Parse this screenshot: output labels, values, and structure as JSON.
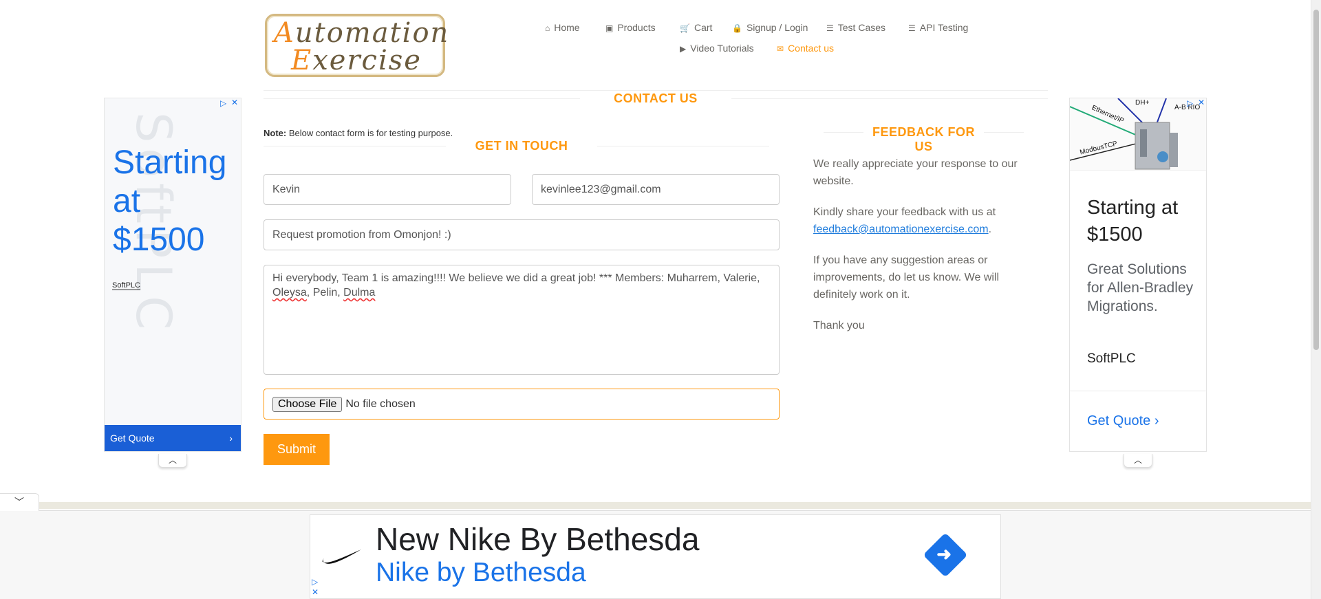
{
  "header": {
    "logo_line1_cap": "A",
    "logo_line1_rest": "utomation",
    "logo_line2_cap": "E",
    "logo_line2_rest": "xercise",
    "nav": [
      {
        "label": "Home",
        "icon": "⌂"
      },
      {
        "label": "Products",
        "icon": "▣"
      },
      {
        "label": "Cart",
        "icon": "🛒"
      },
      {
        "label": "Signup / Login",
        "icon": "🔒"
      },
      {
        "label": "Test Cases",
        "icon": "☰"
      },
      {
        "label": "API Testing",
        "icon": "☰"
      },
      {
        "label": "Video Tutorials",
        "icon": "▶"
      },
      {
        "label": "Contact us",
        "icon": "✉"
      }
    ]
  },
  "contact": {
    "title": "CONTACT US",
    "note_bold": "Note:",
    "note_text": " Below contact form is for testing purpose.",
    "get_in_touch": "GET IN TOUCH",
    "name_value": "Kevin",
    "email_value": "kevinlee123@gmail.com",
    "subject_value": "Request promotion from Omonjon! :)",
    "message_line1": "Hi everybody, Team 1 is amazing!!!! We believe we did a great job! *** Members: Muharrem, Valerie,",
    "message_w1": "Oleysa",
    "message_sep1": ", Pelin, ",
    "message_w2": "Dulma",
    "file_button": "Choose File",
    "file_status": "No file chosen",
    "submit_label": "Submit"
  },
  "feedback": {
    "title": "FEEDBACK FOR US",
    "p1": "We really appreciate your response to our website.",
    "p2_text": "Kindly share your feedback with us at",
    "p2_link": "feedback@automationexercise.com",
    "p2_end": ".",
    "p3": "If you have any suggestion areas or improvements, do let us know. We will definitely work on it.",
    "p4": "Thank you"
  },
  "ad_left": {
    "watermark": "SoftPLC",
    "headline": "Starting at $1500",
    "brand": "SoftPLC",
    "cta": "Get Quote"
  },
  "ad_right": {
    "diagram_labels": [
      "DH+",
      "Ethernet/IP",
      "A-B RIO",
      "ModbusTCP"
    ],
    "headline": "Starting at $1500",
    "sub": "Great Solutions for Allen-Bradley Migrations.",
    "brand": "SoftPLC",
    "cta": "Get Quote"
  },
  "ad_bottom": {
    "title": "New Nike By Bethesda",
    "subtitle": "Nike by Bethesda"
  },
  "colors": {
    "accent": "#fe980f",
    "ad_blue": "#1a73e8"
  }
}
